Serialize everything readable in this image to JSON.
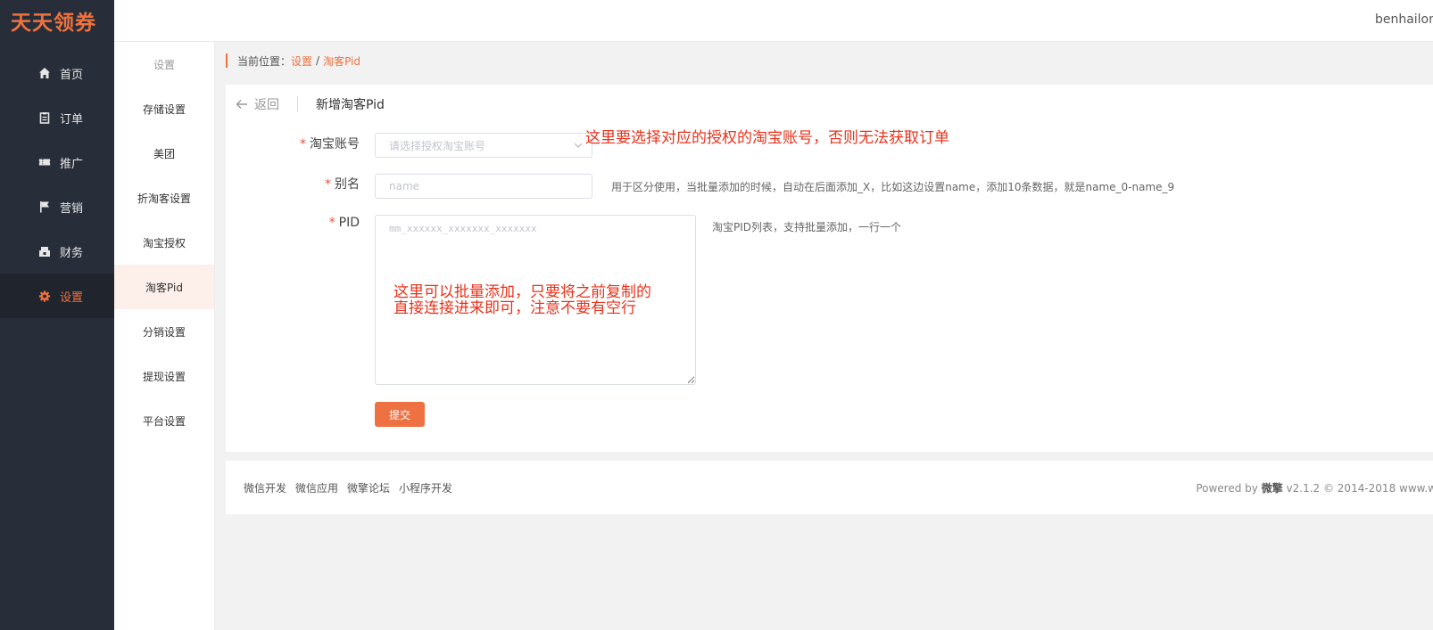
{
  "brand": {
    "name": "天天领券",
    "color": "#f0713d"
  },
  "header": {
    "username": "benhailon"
  },
  "sidebar": {
    "items": [
      {
        "label": "首页",
        "icon": "home-icon",
        "active": false
      },
      {
        "label": "订单",
        "icon": "order-icon",
        "active": false
      },
      {
        "label": "推广",
        "icon": "promote-icon",
        "active": false
      },
      {
        "label": "营销",
        "icon": "flag-icon",
        "active": false
      },
      {
        "label": "财务",
        "icon": "finance-icon",
        "active": false
      },
      {
        "label": "设置",
        "icon": "gear-icon",
        "active": true
      }
    ]
  },
  "subnav": {
    "title": "设置",
    "items": [
      {
        "label": "存储设置",
        "active": false
      },
      {
        "label": "美团",
        "active": false
      },
      {
        "label": "折淘客设置",
        "active": false
      },
      {
        "label": "淘宝授权",
        "active": false
      },
      {
        "label": "淘客Pid",
        "active": true
      },
      {
        "label": "分销设置",
        "active": false
      },
      {
        "label": "提现设置",
        "active": false
      },
      {
        "label": "平台设置",
        "active": false
      }
    ]
  },
  "breadcrumb": {
    "prefix": "当前位置：",
    "items": [
      "设置",
      "淘客Pid"
    ],
    "separator": "/"
  },
  "panel": {
    "back_label": "返回",
    "title": "新增淘客Pid",
    "form": {
      "account": {
        "label": "淘宝账号",
        "placeholder": "请选择授权淘宝账号",
        "annotation": "这里要选择对应的授权的淘宝账号，否则无法获取订单"
      },
      "alias": {
        "label": "别名",
        "placeholder": "name",
        "hint": "用于区分使用，当批量添加的时候，自动在后面添加_X，比如这边设置name，添加10条数据，就是name_0-name_9"
      },
      "pid": {
        "label": "PID",
        "placeholder": "mm_xxxxxx_xxxxxxx_xxxxxxx",
        "hint": "淘宝PID列表，支持批量添加，一行一个",
        "annotation_line1": "这里可以批量添加，只要将之前复制的",
        "annotation_line2": "直接连接进来即可，注意不要有空行"
      },
      "required_mark": "*",
      "submit_label": "提交"
    }
  },
  "footer": {
    "links": [
      "微信开发",
      "微信应用",
      "微擎论坛",
      "小程序开发"
    ],
    "powered_prefix": "Powered by ",
    "powered_brand": "微擎",
    "powered_suffix": " v2.1.2 © 2014-2018 www.w"
  },
  "colors": {
    "accent": "#f0713d",
    "sidebar_bg": "#282e39",
    "annotation": "#e8321b",
    "button": "#ee7142"
  }
}
